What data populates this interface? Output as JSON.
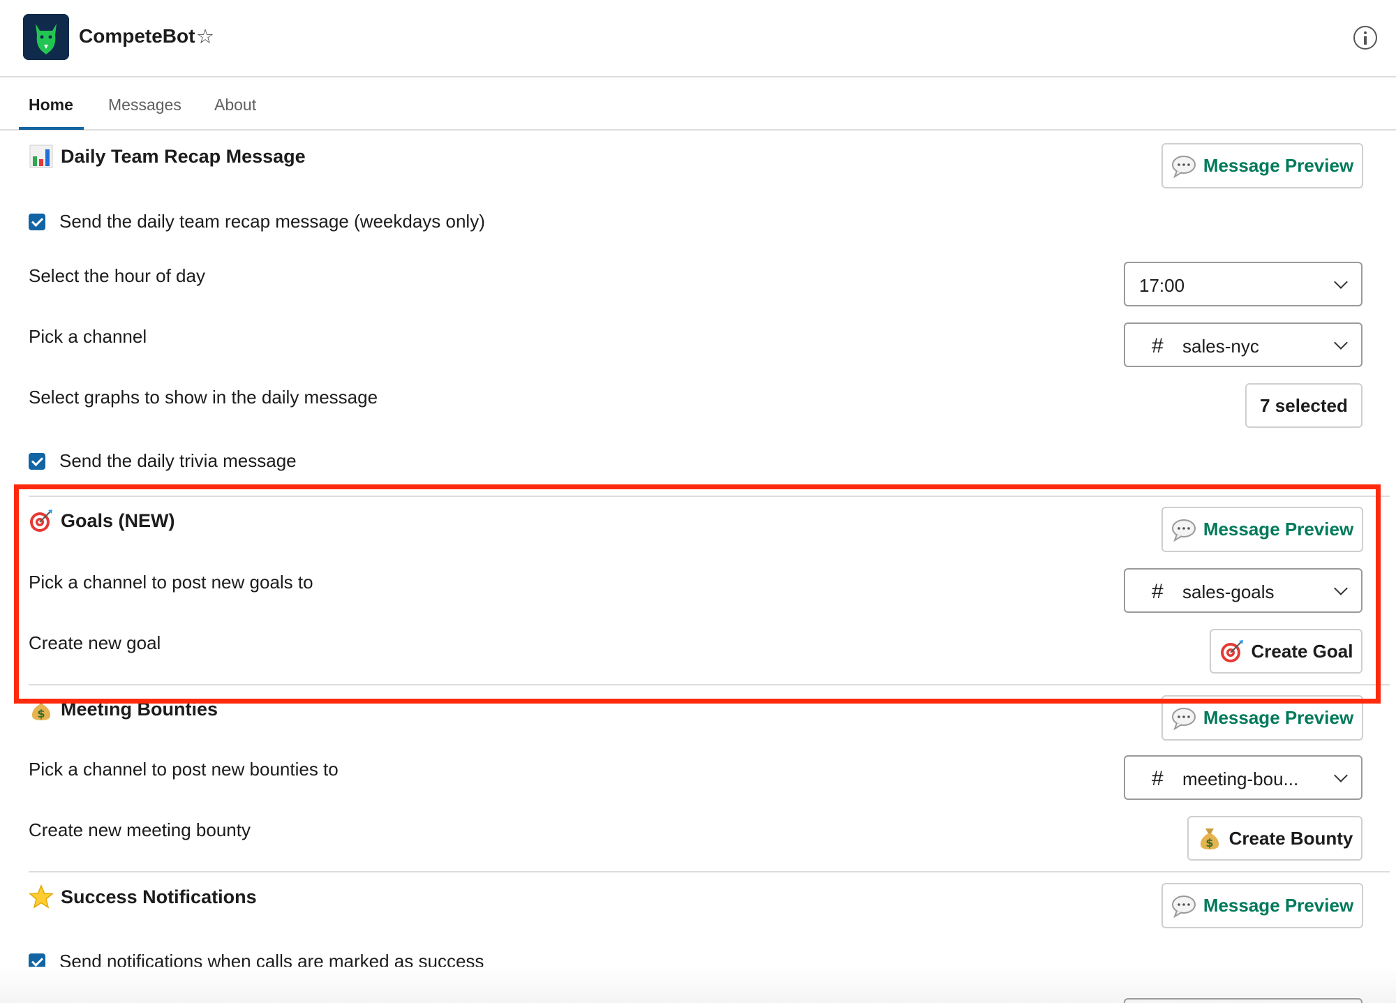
{
  "app": {
    "name": "CompeteBot"
  },
  "tabs": [
    {
      "label": "Home",
      "active": true
    },
    {
      "label": "Messages",
      "active": false
    },
    {
      "label": "About",
      "active": false
    }
  ],
  "recap": {
    "title": "Daily Team Recap Message",
    "preview_label": "Message Preview",
    "send_daily_label": "Send the daily team recap message (weekdays only)",
    "hour_label": "Select the hour of day",
    "hour_value": "17:00",
    "channel_label": "Pick a channel",
    "channel_value": "sales-nyc",
    "graphs_label": "Select graphs to show in the daily message",
    "graphs_value": "7 selected",
    "trivia_label": "Send the daily trivia message"
  },
  "goals": {
    "title": "Goals (NEW)",
    "preview_label": "Message Preview",
    "channel_label": "Pick a channel to post new goals to",
    "channel_value": "sales-goals",
    "create_label": "Create new goal",
    "create_button": "Create Goal"
  },
  "bounties": {
    "title": "Meeting Bounties",
    "preview_label": "Message Preview",
    "channel_label": "Pick a channel to post new bounties to",
    "channel_value": "meeting-bou...",
    "create_label": "Create new meeting bounty",
    "create_button": "Create Bounty"
  },
  "success": {
    "title": "Success Notifications",
    "preview_label": "Message Preview",
    "send_label": "Send notifications when calls are marked as success"
  },
  "icons": {
    "bar_chart": "bar-chart-emoji",
    "target": "direct-hit-emoji",
    "money_bag": "money-bag-emoji",
    "star": "star-emoji",
    "speech": "speech-bubble-emoji"
  },
  "colors": {
    "accent": "#1264a3",
    "preview_text": "#007a5a",
    "highlight": "#ff2a0d"
  }
}
